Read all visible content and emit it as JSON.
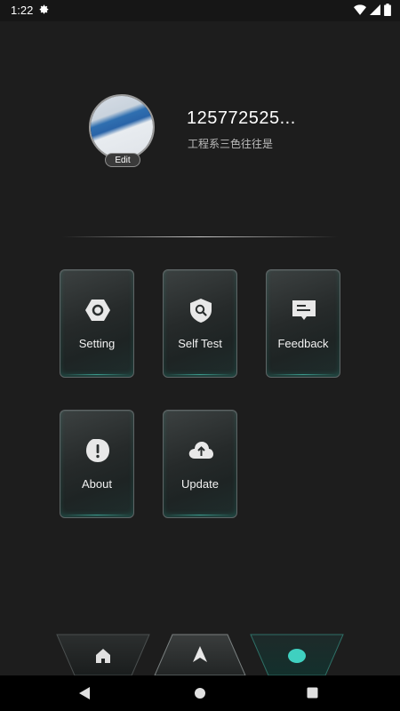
{
  "status_bar": {
    "time": "1:22"
  },
  "profile": {
    "user_id": "125772525...",
    "subtitle": "工程系三色往往是",
    "edit_label": "Edit"
  },
  "tiles": [
    {
      "label": "Setting",
      "icon": "settings-hex-icon"
    },
    {
      "label": "Self Test",
      "icon": "shield-search-icon"
    },
    {
      "label": "Feedback",
      "icon": "message-icon"
    },
    {
      "label": "About",
      "icon": "info-exclamation-icon"
    },
    {
      "label": "Update",
      "icon": "cloud-upload-icon"
    }
  ],
  "bottom_nav": [
    {
      "icon": "home-icon"
    },
    {
      "icon": "navigate-arrow-icon"
    },
    {
      "icon": "dot-icon",
      "color": "#3fd0c0"
    }
  ],
  "colors": {
    "accent": "#3fd0c0",
    "background": "#1d1d1d"
  }
}
